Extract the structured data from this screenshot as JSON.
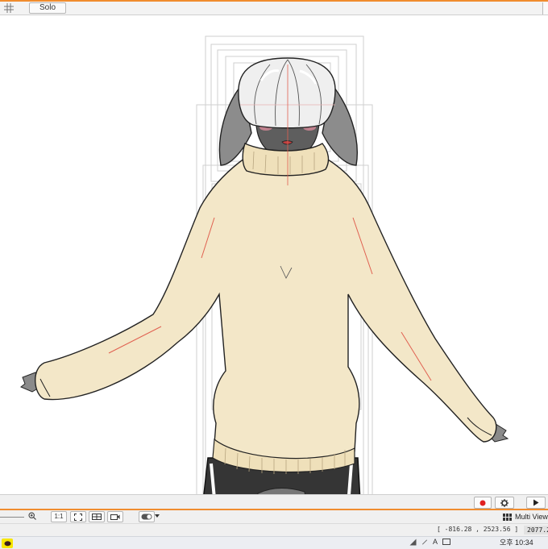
{
  "top_bar": {
    "solo_label": "Solo"
  },
  "canvas": {
    "character": "sweater-figure"
  },
  "toolbar": {
    "zoom_reset_label": "1:1"
  },
  "view_menu": {
    "label": "Multi View"
  },
  "status": {
    "coordinates": "[ -816.28 , 2523.56 ]",
    "frame": "2077.2"
  },
  "taskbar": {
    "clock": "오후 10:34",
    "ime_label": "A"
  },
  "colors": {
    "accent": "#f08c2e",
    "sweater": "#f3e7c8",
    "record": "#e02020"
  },
  "icons": [
    "grid-icon",
    "zoom-in-icon",
    "fit-icon",
    "frame-icon",
    "camera-icon",
    "toggle-icon",
    "chevron-down-icon",
    "record-icon",
    "gear-icon",
    "play-icon",
    "view-grid-icon",
    "kakao-icon"
  ]
}
